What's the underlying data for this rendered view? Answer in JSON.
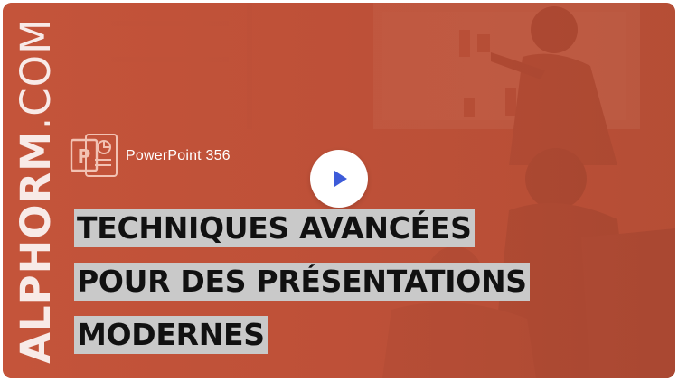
{
  "brand": {
    "part1": "ALPHORM",
    "part2": ".COM"
  },
  "product": {
    "name": "PowerPoint 356",
    "icon": "powerpoint-icon",
    "icon_letter": "P"
  },
  "video": {
    "play_icon": "play-icon"
  },
  "title": {
    "lines": [
      "TECHNIQUES AVANCÉES",
      "POUR DES PRÉSENTATIONS",
      "MODERNES"
    ]
  },
  "colors": {
    "accent": "#c4543a",
    "highlight": "#c9c9c9",
    "play": "#3d5bd9"
  }
}
